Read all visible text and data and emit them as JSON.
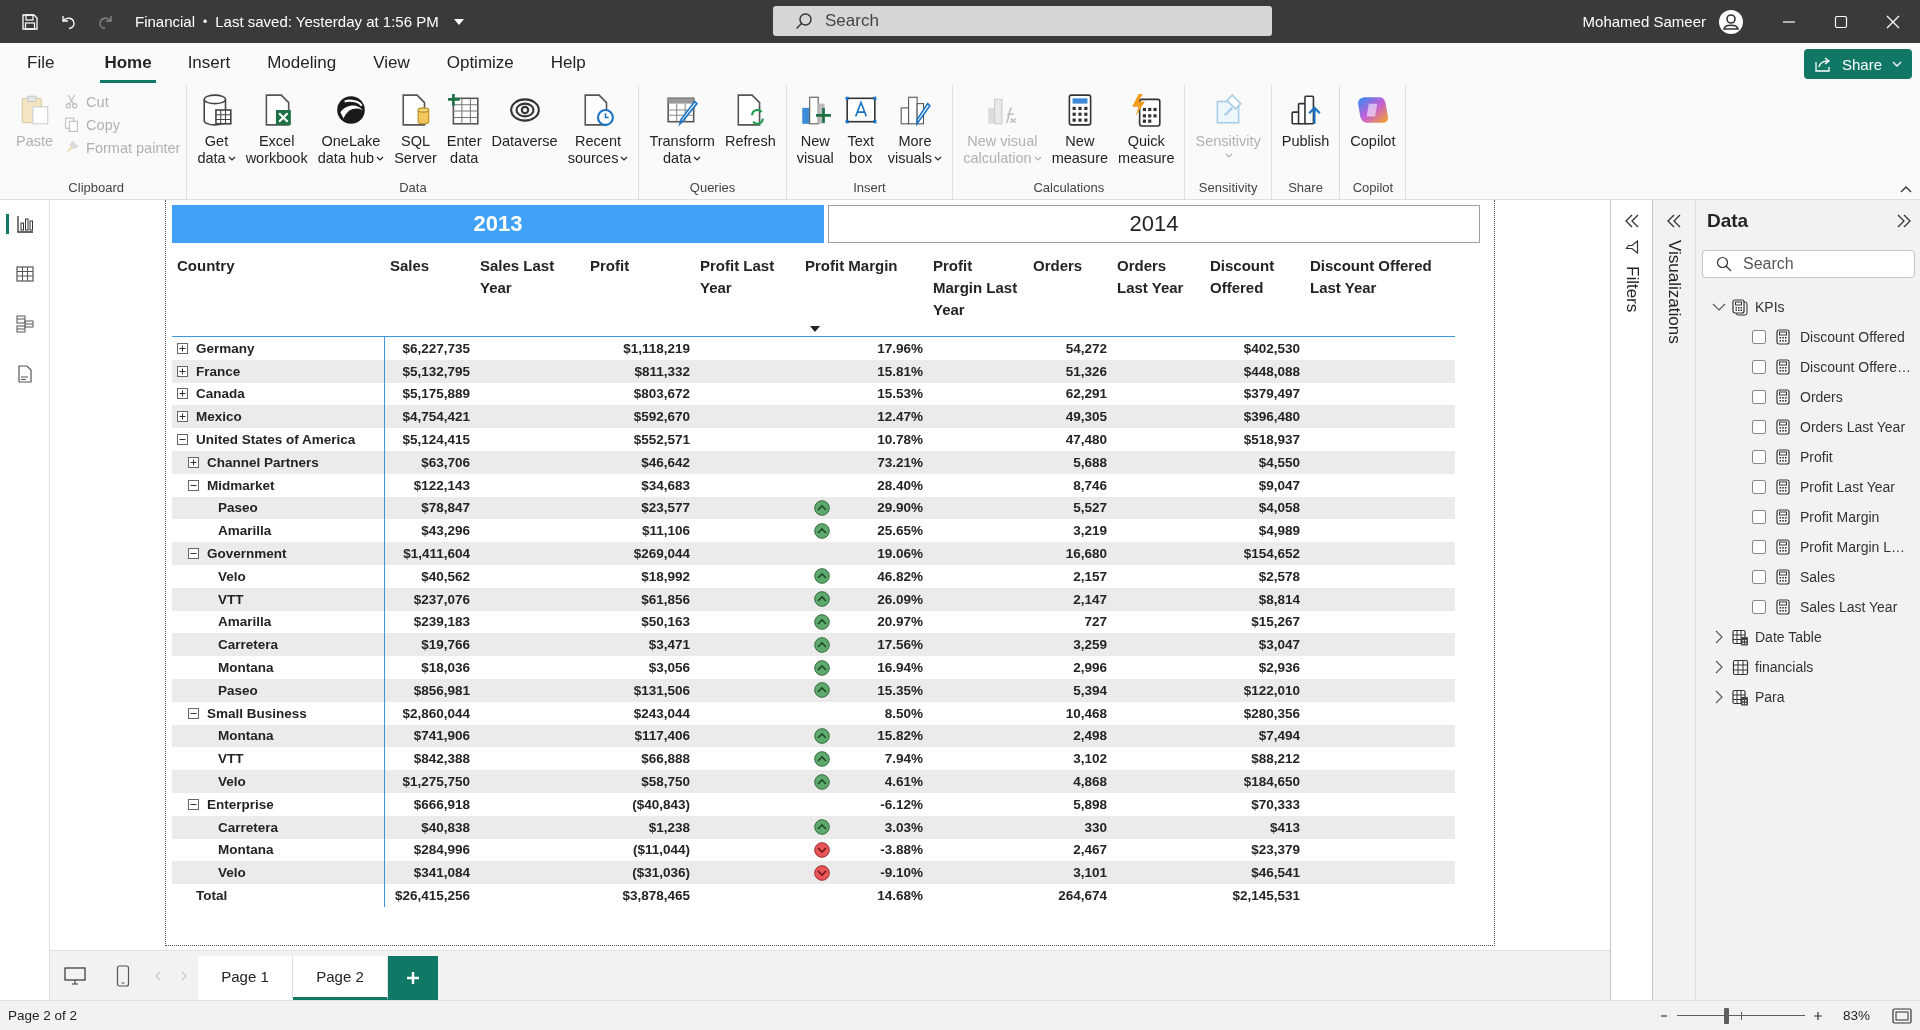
{
  "title_bar": {
    "file_name": "Financial",
    "separator": "•",
    "save_status": "Last saved: Yesterday at 1:56 PM",
    "search": {
      "placeholder": "Search"
    },
    "user": "Mohamed Sameer"
  },
  "menu_tabs": [
    {
      "label": "File",
      "selected": false
    },
    {
      "label": "Home",
      "selected": true
    },
    {
      "label": "Insert",
      "selected": false
    },
    {
      "label": "Modeling",
      "selected": false
    },
    {
      "label": "View",
      "selected": false
    },
    {
      "label": "Optimize",
      "selected": false
    },
    {
      "label": "Help",
      "selected": false
    }
  ],
  "share_button": "Share",
  "ribbon": [
    {
      "name": "Clipboard",
      "buttons": [
        {
          "label": "Paste",
          "kind": "large",
          "disabled": true,
          "dropdown": false
        },
        {
          "label": "Cut",
          "kind": "small",
          "disabled": true,
          "dropdown": false
        },
        {
          "label": "Copy",
          "kind": "small",
          "disabled": true,
          "dropdown": false
        },
        {
          "label": "Format painter",
          "kind": "small",
          "disabled": true,
          "dropdown": false
        }
      ]
    },
    {
      "name": "Data",
      "buttons": [
        {
          "label": "Get\ndata",
          "kind": "large",
          "disabled": false,
          "dropdown": true
        },
        {
          "label": "Excel\nworkbook",
          "kind": "large",
          "disabled": false,
          "dropdown": false
        },
        {
          "label": "OneLake\ndata hub",
          "kind": "large",
          "disabled": false,
          "dropdown": true
        },
        {
          "label": "SQL\nServer",
          "kind": "large",
          "disabled": false,
          "dropdown": false
        },
        {
          "label": "Enter\ndata",
          "kind": "large",
          "disabled": false,
          "dropdown": false
        },
        {
          "label": "Dataverse",
          "kind": "large",
          "disabled": false,
          "dropdown": false
        },
        {
          "label": "Recent\nsources",
          "kind": "large",
          "disabled": false,
          "dropdown": true
        }
      ]
    },
    {
      "name": "Queries",
      "buttons": [
        {
          "label": "Transform\ndata",
          "kind": "large",
          "disabled": false,
          "dropdown": true
        },
        {
          "label": "Refresh",
          "kind": "large",
          "disabled": false,
          "dropdown": false
        }
      ]
    },
    {
      "name": "Insert",
      "buttons": [
        {
          "label": "New\nvisual",
          "kind": "large",
          "disabled": false,
          "dropdown": false
        },
        {
          "label": "Text\nbox",
          "kind": "large",
          "disabled": false,
          "dropdown": false
        },
        {
          "label": "More\nvisuals",
          "kind": "large",
          "disabled": false,
          "dropdown": true
        }
      ]
    },
    {
      "name": "Calculations",
      "buttons": [
        {
          "label": "New visual\ncalculation",
          "kind": "large",
          "disabled": true,
          "dropdown": true
        },
        {
          "label": "New\nmeasure",
          "kind": "large",
          "disabled": false,
          "dropdown": false
        },
        {
          "label": "Quick\nmeasure",
          "kind": "large",
          "disabled": false,
          "dropdown": false
        }
      ]
    },
    {
      "name": "Sensitivity",
      "buttons": [
        {
          "label": "Sensitivity",
          "kind": "large",
          "disabled": true,
          "dropdown": true
        }
      ]
    },
    {
      "name": "Share",
      "buttons": [
        {
          "label": "Publish",
          "kind": "large",
          "disabled": false,
          "dropdown": false
        }
      ]
    },
    {
      "name": "Copilot",
      "buttons": [
        {
          "label": "Copilot",
          "kind": "large",
          "disabled": false,
          "dropdown": false
        }
      ]
    }
  ],
  "year_slicer": [
    {
      "label": "2013",
      "selected": true
    },
    {
      "label": "2014",
      "selected": false
    }
  ],
  "table": {
    "columns": [
      {
        "label": "Country",
        "kind": "label",
        "sorted": false
      },
      {
        "label": "Sales",
        "kind": "value",
        "sorted": false
      },
      {
        "label": "Sales Last Year",
        "kind": "blank",
        "sorted": false
      },
      {
        "label": "Profit",
        "kind": "value",
        "sorted": false
      },
      {
        "label": "Profit Last Year",
        "kind": "blank",
        "sorted": false
      },
      {
        "label": "Profit Margin",
        "kind": "trend_value",
        "sorted": true
      },
      {
        "label": "Profit Margin Last Year",
        "kind": "blank",
        "sorted": false
      },
      {
        "label": "Orders",
        "kind": "value",
        "sorted": false
      },
      {
        "label": "Orders Last Year",
        "kind": "blank",
        "sorted": false
      },
      {
        "label": "Discount Offered",
        "kind": "value",
        "sorted": false
      },
      {
        "label": "Discount Offered Last Year",
        "kind": "blank",
        "sorted": false
      }
    ],
    "rows": [
      {
        "label": "Germany",
        "expanded": false,
        "values": [
          "$6,227,735",
          "$1,118,219",
          "17.96%",
          "54,272",
          "$402,530"
        ]
      },
      {
        "label": "France",
        "expanded": false,
        "values": [
          "$5,132,795",
          "$811,332",
          "15.81%",
          "51,326",
          "$448,088"
        ]
      },
      {
        "label": "Canada",
        "expanded": false,
        "values": [
          "$5,175,889",
          "$803,672",
          "15.53%",
          "62,291",
          "$379,497"
        ]
      },
      {
        "label": "Mexico",
        "expanded": false,
        "values": [
          "$4,754,421",
          "$592,670",
          "12.47%",
          "49,305",
          "$396,480"
        ]
      },
      {
        "label": "United States of America",
        "expanded": true,
        "values": [
          "$5,124,415",
          "$552,571",
          "10.78%",
          "47,480",
          "$518,937"
        ],
        "children": [
          {
            "label": "Channel Partners",
            "expanded": false,
            "values": [
              "$63,706",
              "$46,642",
              "73.21%",
              "5,688",
              "$4,550"
            ]
          },
          {
            "label": "Midmarket",
            "expanded": true,
            "values": [
              "$122,143",
              "$34,683",
              "28.40%",
              "8,746",
              "$9,047"
            ],
            "children": [
              {
                "label": "Paseo",
                "rising": true,
                "values": [
                  "$78,847",
                  "$23,577",
                  "29.90%",
                  "5,527",
                  "$4,058"
                ]
              },
              {
                "label": "Amarilla",
                "rising": true,
                "values": [
                  "$43,296",
                  "$11,106",
                  "25.65%",
                  "3,219",
                  "$4,989"
                ]
              }
            ]
          },
          {
            "label": "Government",
            "expanded": true,
            "values": [
              "$1,411,604",
              "$269,044",
              "19.06%",
              "16,680",
              "$154,652"
            ],
            "children": [
              {
                "label": "Velo",
                "rising": true,
                "values": [
                  "$40,562",
                  "$18,992",
                  "46.82%",
                  "2,157",
                  "$2,578"
                ]
              },
              {
                "label": "VTT",
                "rising": true,
                "values": [
                  "$237,076",
                  "$61,856",
                  "26.09%",
                  "2,147",
                  "$8,814"
                ]
              },
              {
                "label": "Amarilla",
                "rising": true,
                "values": [
                  "$239,183",
                  "$50,163",
                  "20.97%",
                  "727",
                  "$15,267"
                ]
              },
              {
                "label": "Carretera",
                "rising": true,
                "values": [
                  "$19,766",
                  "$3,471",
                  "17.56%",
                  "3,259",
                  "$3,047"
                ]
              },
              {
                "label": "Montana",
                "rising": true,
                "values": [
                  "$18,036",
                  "$3,056",
                  "16.94%",
                  "2,996",
                  "$2,936"
                ]
              },
              {
                "label": "Paseo",
                "rising": true,
                "values": [
                  "$856,981",
                  "$131,506",
                  "15.35%",
                  "5,394",
                  "$122,010"
                ]
              }
            ]
          },
          {
            "label": "Small Business",
            "expanded": true,
            "values": [
              "$2,860,044",
              "$243,044",
              "8.50%",
              "10,468",
              "$280,356"
            ],
            "children": [
              {
                "label": "Montana",
                "rising": true,
                "values": [
                  "$741,906",
                  "$117,406",
                  "15.82%",
                  "2,498",
                  "$7,494"
                ]
              },
              {
                "label": "VTT",
                "rising": true,
                "values": [
                  "$842,388",
                  "$66,888",
                  "7.94%",
                  "3,102",
                  "$88,212"
                ]
              },
              {
                "label": "Velo",
                "rising": true,
                "values": [
                  "$1,275,750",
                  "$58,750",
                  "4.61%",
                  "4,868",
                  "$184,650"
                ]
              }
            ]
          },
          {
            "label": "Enterprise",
            "expanded": true,
            "values": [
              "$666,918",
              "($40,843)",
              "-6.12%",
              "5,898",
              "$70,333"
            ],
            "children": [
              {
                "label": "Carretera",
                "rising": true,
                "values": [
                  "$40,838",
                  "$1,238",
                  "3.03%",
                  "330",
                  "$413"
                ]
              },
              {
                "label": "Montana",
                "rising": false,
                "values": [
                  "$284,996",
                  "($11,044)",
                  "-3.88%",
                  "2,467",
                  "$23,379"
                ]
              },
              {
                "label": "Velo",
                "rising": false,
                "values": [
                  "$341,084",
                  "($31,036)",
                  "-9.10%",
                  "3,101",
                  "$46,541"
                ]
              }
            ]
          }
        ]
      }
    ],
    "total": {
      "label": "Total",
      "values": [
        "$26,415,256",
        "$3,878,465",
        "14.68%",
        "264,674",
        "$2,145,531"
      ]
    }
  },
  "filters_pane": {
    "label": "Filters"
  },
  "visualizations_pane": {
    "label": "Visualizations"
  },
  "data_pane": {
    "title": "Data",
    "search": {
      "placeholder": "Search"
    },
    "tree": [
      {
        "label": "KPIs",
        "kind": "measure_table",
        "expanded": true,
        "children": [
          {
            "label": "Discount Offered",
            "kind": "measure",
            "checked": false
          },
          {
            "label": "Discount Offere…",
            "kind": "measure",
            "checked": false
          },
          {
            "label": "Orders",
            "kind": "measure",
            "checked": false
          },
          {
            "label": "Orders Last Year",
            "kind": "measure",
            "checked": false
          },
          {
            "label": "Profit",
            "kind": "measure",
            "checked": false
          },
          {
            "label": "Profit Last Year",
            "kind": "measure",
            "checked": false
          },
          {
            "label": "Profit Margin",
            "kind": "measure",
            "checked": false
          },
          {
            "label": "Profit Margin L…",
            "kind": "measure",
            "checked": false
          },
          {
            "label": "Sales",
            "kind": "measure",
            "checked": false
          },
          {
            "label": "Sales Last Year",
            "kind": "measure",
            "checked": false
          }
        ]
      },
      {
        "label": "Date Table",
        "kind": "calculated_table",
        "expanded": false
      },
      {
        "label": "financials",
        "kind": "table",
        "expanded": false
      },
      {
        "label": "Para",
        "kind": "calculated_table",
        "expanded": false
      }
    ]
  },
  "page_tabs": [
    {
      "label": "Page 1",
      "selected": false
    },
    {
      "label": "Page 2",
      "selected": true
    }
  ],
  "status_bar": {
    "page_info": "Page 2 of 2",
    "zoom": {
      "level": 0.38,
      "reading": "83%"
    }
  }
}
